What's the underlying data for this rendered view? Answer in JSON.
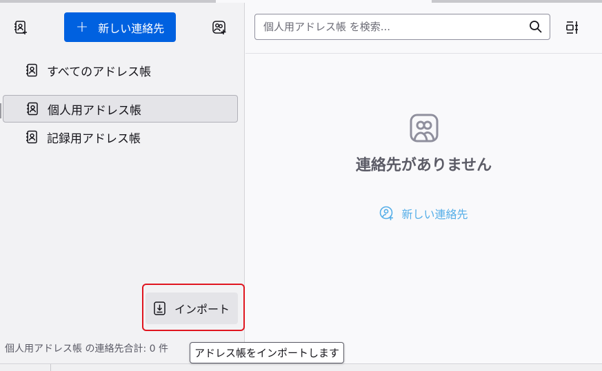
{
  "sidebar": {
    "new_contact_label": "新しい連絡先",
    "icons": {
      "new_book": "address-book-add-icon",
      "new_list": "contact-list-add-icon"
    },
    "books": [
      {
        "label": "すべてのアドレス帳",
        "icon": "address-book-icon",
        "selected": false
      },
      {
        "label": "個人用アドレス帳",
        "icon": "address-book-icon",
        "selected": true
      },
      {
        "label": "記録用アドレス帳",
        "icon": "address-book-icon",
        "selected": false
      }
    ],
    "import_label": "インポート",
    "status_text": "個人用アドレス帳 の連絡先合計: 0 件"
  },
  "search": {
    "placeholder": "個人用アドレス帳 を検索..."
  },
  "empty_state": {
    "title": "連絡先がありません",
    "new_contact_link": "新しい連絡先"
  },
  "tooltip": {
    "text": "アドレス帳をインポートします"
  },
  "colors": {
    "accent": "#0061e0",
    "highlight": "#e0141e",
    "link": "#55aee8"
  }
}
